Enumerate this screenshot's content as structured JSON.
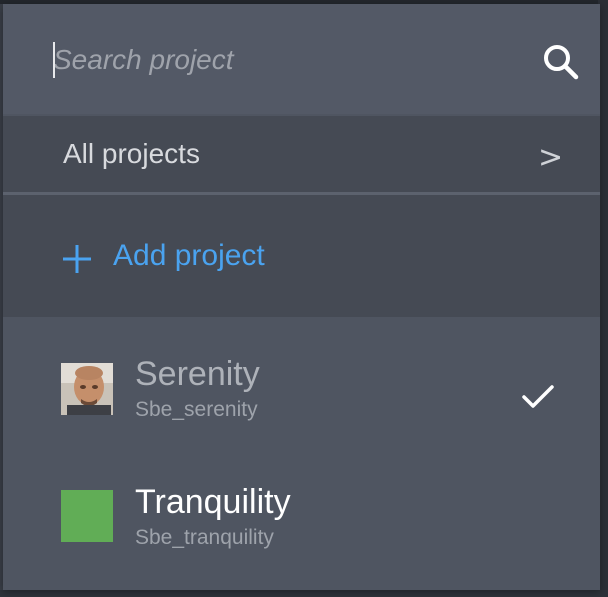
{
  "search": {
    "placeholder": "Search project",
    "value": "",
    "icon": "search-icon"
  },
  "all_projects": {
    "label": "All projects",
    "chevron": ">"
  },
  "add_project": {
    "label": "Add project",
    "icon": "plus-icon",
    "color": "#4aa3f0"
  },
  "projects": [
    {
      "name": "Serenity",
      "key": "Sbe_serenity",
      "avatar": "user-photo-avatar",
      "selected": true,
      "selected_icon": "checkmark-icon"
    },
    {
      "name": "Tranquility",
      "key": "Sbe_tranquility",
      "avatar": "green-square-avatar",
      "avatar_color": "#61ad56",
      "selected": false
    }
  ],
  "theme": {
    "dropdown_bg": "#4f5561",
    "section_bg": "#454a54",
    "accent": "#4aa3f0"
  }
}
